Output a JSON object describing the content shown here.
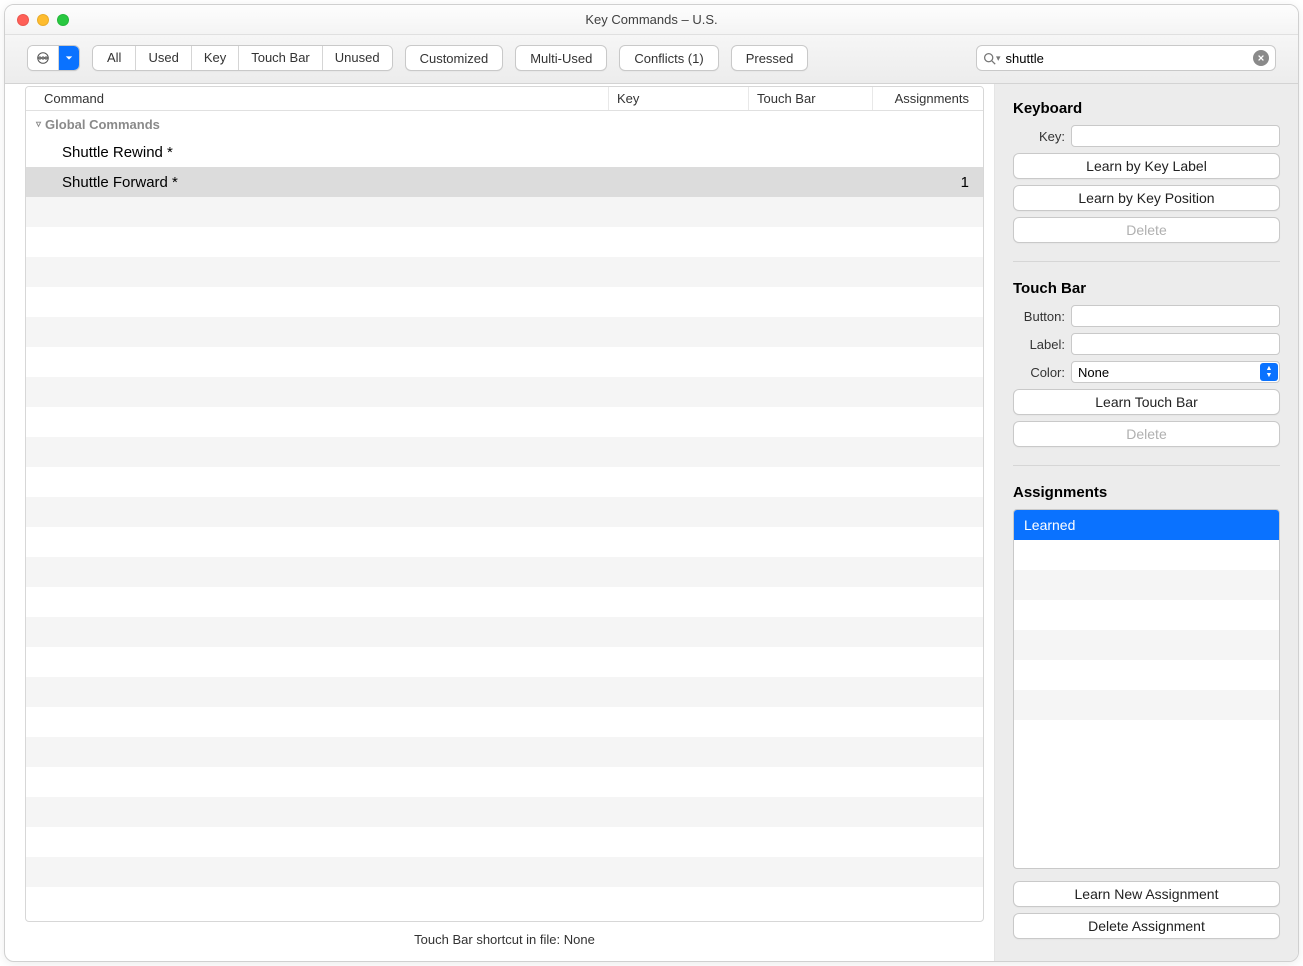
{
  "window": {
    "title": "Key Commands – U.S."
  },
  "toolbar": {
    "filters": {
      "all": "All",
      "used": "Used",
      "key": "Key",
      "touchbar": "Touch Bar",
      "unused": "Unused"
    },
    "customized": "Customized",
    "multi_used": "Multi-Used",
    "conflicts": "Conflicts (1)",
    "pressed": "Pressed",
    "search_value": "shuttle"
  },
  "table": {
    "headers": {
      "command": "Command",
      "key": "Key",
      "touchbar": "Touch Bar",
      "assignments": "Assignments"
    },
    "group": "Global Commands",
    "rows": [
      {
        "command": "Shuttle Rewind *",
        "key": "",
        "touchbar": "",
        "assignments": "",
        "selected": false
      },
      {
        "command": "Shuttle Forward *",
        "key": "",
        "touchbar": "",
        "assignments": "1",
        "selected": true
      }
    ]
  },
  "footer": "Touch Bar shortcut in file: None",
  "sidebar": {
    "keyboard": {
      "title": "Keyboard",
      "key_label": "Key:",
      "learn_label_btn": "Learn by Key Label",
      "learn_pos_btn": "Learn by Key Position",
      "delete_btn": "Delete"
    },
    "touchbar": {
      "title": "Touch Bar",
      "button_label": "Button:",
      "label_label": "Label:",
      "color_label": "Color:",
      "color_value": "None",
      "learn_btn": "Learn Touch Bar",
      "delete_btn": "Delete"
    },
    "assignments": {
      "title": "Assignments",
      "items": [
        "Learned"
      ],
      "learn_new_btn": "Learn New Assignment",
      "delete_assign_btn": "Delete Assignment"
    }
  }
}
